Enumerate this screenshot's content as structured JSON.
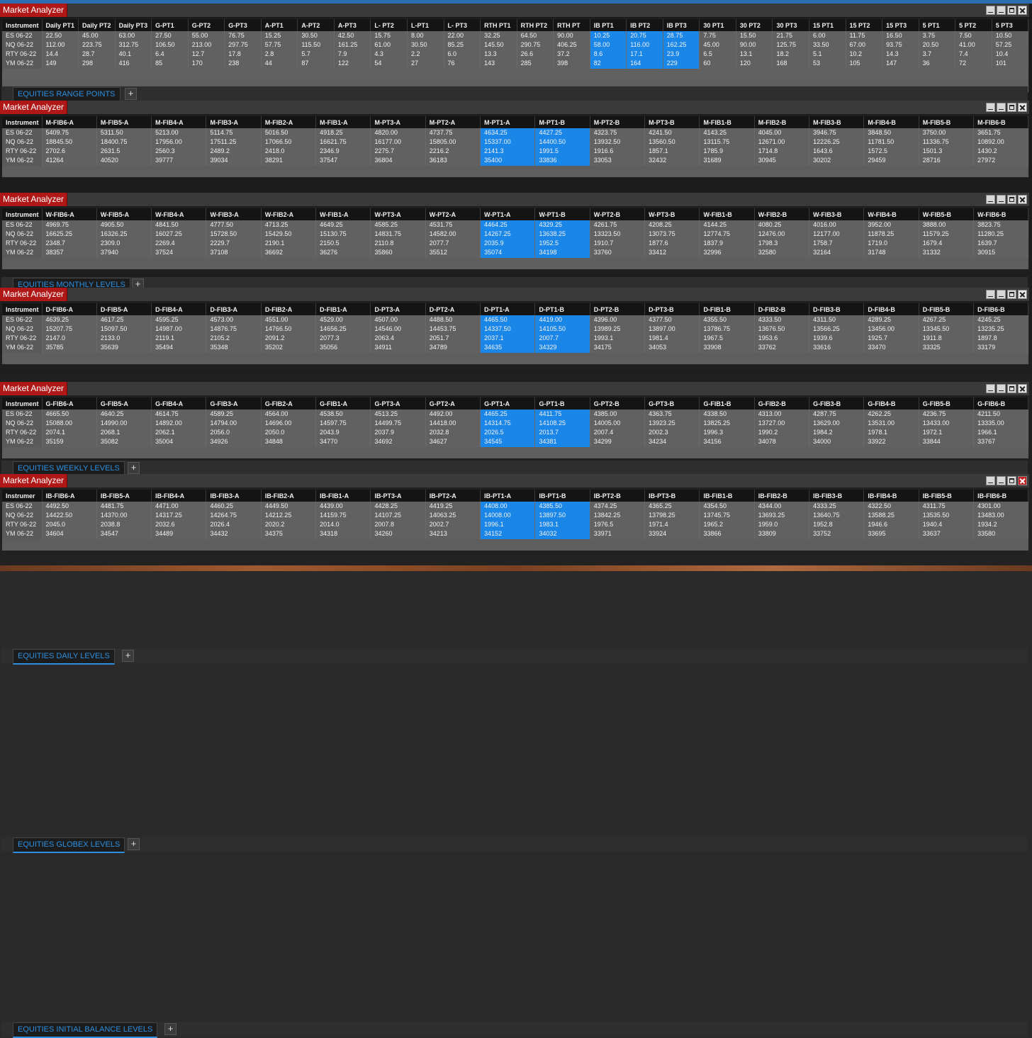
{
  "app": {
    "title": "Market Analyzer"
  },
  "panels": [
    {
      "tab": "EQUITIES RANGE POINTS",
      "headers": [
        "Instrument",
        "Daily PT1",
        "Daily PT2",
        "Daily PT3",
        "G-PT1",
        "G-PT2",
        "G-PT3",
        "A-PT1",
        "A-PT2",
        "A-PT3",
        "L- PT2",
        "L-PT1",
        "L- PT3",
        "RTH PT1",
        "RTH PT2",
        "RTH PT",
        "IB PT1",
        "IB PT2",
        "IB PT3",
        "30 PT1",
        "30 PT2",
        "30 PT3",
        "15 PT1",
        "15 PT2",
        "15 PT3",
        "5 PT1",
        "5 PT2",
        "5 PT3"
      ],
      "rows": [
        [
          "ES 06-22",
          "22.50",
          "45.00",
          "63.00",
          "27.50",
          "55.00",
          "76.75",
          "15.25",
          "30.50",
          "42.50",
          "15.75",
          "8.00",
          "22.00",
          "32.25",
          "64.50",
          "90.00",
          "10.25",
          "20.75",
          "28.75",
          "7.75",
          "15.50",
          "21.75",
          "6.00",
          "11.75",
          "16.50",
          "3.75",
          "7.50",
          "10.50"
        ],
        [
          "NQ 06-22",
          "112.00",
          "223.75",
          "312.75",
          "106.50",
          "213.00",
          "297.75",
          "57.75",
          "115.50",
          "161.25",
          "61.00",
          "30.50",
          "85.25",
          "145.50",
          "290.75",
          "406.25",
          "58.00",
          "116.00",
          "162.25",
          "45.00",
          "90.00",
          "125.75",
          "33.50",
          "67.00",
          "93.75",
          "20.50",
          "41.00",
          "57.25"
        ],
        [
          "RTY 06-22",
          "14.4",
          "28.7",
          "40.1",
          "6.4",
          "12.7",
          "17.8",
          "2.8",
          "5.7",
          "7.9",
          "4.3",
          "2.2",
          "6.0",
          "13.3",
          "26.6",
          "37.2",
          "8.6",
          "17.1",
          "23.9",
          "6.5",
          "13.1",
          "18.2",
          "5.1",
          "10.2",
          "14.3",
          "3.7",
          "7.4",
          "10.4"
        ],
        [
          "YM 06-22",
          "149",
          "298",
          "416",
          "85",
          "170",
          "238",
          "44",
          "87",
          "122",
          "54",
          "27",
          "76",
          "143",
          "285",
          "398",
          "82",
          "164",
          "229",
          "60",
          "120",
          "168",
          "53",
          "105",
          "147",
          "36",
          "72",
          "101"
        ]
      ]
    },
    {
      "tab": "EQUITIES MONTHLY LEVELS",
      "headers": [
        "Instrument",
        "M-FIB6-A",
        "M-FIB5-A",
        "M-FIB4-A",
        "M-FIB3-A",
        "M-FIB2-A",
        "M-FIB1-A",
        "M-PT3-A",
        "M-PT2-A",
        "M-PT1-A",
        "M-PT1-B",
        "M-PT2-B",
        "M-PT3-B",
        "M-FIB1-B",
        "M-FIB2-B",
        "M-FIB3-B",
        "M-FIB4-B",
        "M-FIB5-B",
        "M-FIB6-B"
      ],
      "rows": [
        [
          "ES 06-22",
          "5409.75",
          "5311.50",
          "5213.00",
          "5114.75",
          "5016.50",
          "4918.25",
          "4820.00",
          "4737.75",
          "4634.25",
          "4427.25",
          "4323.75",
          "4241.50",
          "4143.25",
          "4045.00",
          "3946.75",
          "3848.50",
          "3750.00",
          "3651.75"
        ],
        [
          "NQ 06-22",
          "18845.50",
          "18400.75",
          "17956.00",
          "17511.25",
          "17066.50",
          "16621.75",
          "16177.00",
          "15805.00",
          "15337.00",
          "14400.50",
          "13932.50",
          "13560.50",
          "13115.75",
          "12671.00",
          "12226.25",
          "11781.50",
          "11336.75",
          "10892.00"
        ],
        [
          "RTY 06-22",
          "2702.6",
          "2631.5",
          "2560.3",
          "2489.2",
          "2418.0",
          "2346.9",
          "2275.7",
          "2216.2",
          "2141.3",
          "1991.5",
          "1916.6",
          "1857.1",
          "1785.9",
          "1714.8",
          "1643.6",
          "1572.5",
          "1501.3",
          "1430.2"
        ],
        [
          "YM 06-22",
          "41264",
          "40520",
          "39777",
          "39034",
          "38291",
          "37547",
          "36804",
          "36183",
          "35400",
          "33836",
          "33053",
          "32432",
          "31689",
          "30945",
          "30202",
          "29459",
          "28716",
          "27972"
        ]
      ]
    },
    {
      "tab": "EQUITIES WEEKLY LEVELS",
      "headers": [
        "Instrument",
        "W-FIB6-A",
        "W-FIB5-A",
        "W-FIB4-A",
        "W-FIB3-A",
        "W-FIB2-A",
        "W-FIB1-A",
        "W-PT3-A",
        "W-PT2-A",
        "W-PT1-A",
        "W-PT1-B",
        "W-PT2-B",
        "W-PT3-B",
        "W-FIB1-B",
        "W-FIB2-B",
        "W-FIB3-B",
        "W-FIB4-B",
        "W-FIB5-B",
        "W-FIB6-B"
      ],
      "rows": [
        [
          "ES 06-22",
          "4969.75",
          "4905.50",
          "4841.50",
          "4777.50",
          "4713.25",
          "4649.25",
          "4585.25",
          "4531.75",
          "4464.25",
          "4329.25",
          "4261.75",
          "4208.25",
          "4144.25",
          "4080.25",
          "4016.00",
          "3952.00",
          "3888.00",
          "3823.75"
        ],
        [
          "NQ 06-22",
          "16625.25",
          "16326.25",
          "16027.25",
          "15728.50",
          "15429.50",
          "15130.75",
          "14831.75",
          "14582.00",
          "14267.25",
          "13638.25",
          "13323.50",
          "13073.75",
          "12774.75",
          "12476.00",
          "12177.00",
          "11878.25",
          "11579.25",
          "11280.25"
        ],
        [
          "RTY 06-22",
          "2348.7",
          "2309.0",
          "2269.4",
          "2229.7",
          "2190.1",
          "2150.5",
          "2110.8",
          "2077.7",
          "2035.9",
          "1952.5",
          "1910.7",
          "1877.6",
          "1837.9",
          "1798.3",
          "1758.7",
          "1719.0",
          "1679.4",
          "1639.7"
        ],
        [
          "YM 06-22",
          "38357",
          "37940",
          "37524",
          "37108",
          "36692",
          "36276",
          "35860",
          "35512",
          "35074",
          "34198",
          "33760",
          "33412",
          "32996",
          "32580",
          "32164",
          "31748",
          "31332",
          "30915"
        ]
      ]
    },
    {
      "tab": "EQUITIES DAILY LEVELS",
      "headers": [
        "Instrument",
        "D-FIB6-A",
        "D-FIB5-A",
        "D-FIB4-A",
        "D-FIB3-A",
        "D-FIB2-A",
        "D-FIB1-A",
        "D-PT3-A",
        "D-PT2-A",
        "D-PT1-A",
        "D-PT1-B",
        "D-PT2-B",
        "D-PT3-B",
        "D-FIB1-B",
        "D-FIB2-B",
        "D-FIB3-B",
        "D-FIB4-B",
        "D-FIB5-B",
        "D-FIB6-B"
      ],
      "rows": [
        [
          "ES 06-22",
          "4639.25",
          "4617.25",
          "4595.25",
          "4573.00",
          "4551.00",
          "4529.00",
          "4507.00",
          "4488.50",
          "4465.50",
          "4419.00",
          "4396.00",
          "4377.50",
          "4355.50",
          "4333.50",
          "4311.50",
          "4289.25",
          "4267.25",
          "4245.25"
        ],
        [
          "NQ 06-22",
          "15207.75",
          "15097.50",
          "14987.00",
          "14876.75",
          "14766.50",
          "14656.25",
          "14546.00",
          "14453.75",
          "14337.50",
          "14105.50",
          "13989.25",
          "13897.00",
          "13786.75",
          "13676.50",
          "13566.25",
          "13456.00",
          "13345.50",
          "13235.25"
        ],
        [
          "RTY 06-22",
          "2147.0",
          "2133.0",
          "2119.1",
          "2105.2",
          "2091.2",
          "2077.3",
          "2063.4",
          "2051.7",
          "2037.1",
          "2007.7",
          "1993.1",
          "1981.4",
          "1967.5",
          "1953.6",
          "1939.6",
          "1925.7",
          "1911.8",
          "1897.8"
        ],
        [
          "YM 06-22",
          "35785",
          "35639",
          "35494",
          "35348",
          "35202",
          "35056",
          "34911",
          "34789",
          "34635",
          "34329",
          "34175",
          "34053",
          "33908",
          "33762",
          "33616",
          "33470",
          "33325",
          "33179"
        ]
      ]
    },
    {
      "tab": "EQUITIES GLOBEX LEVELS",
      "headers": [
        "Instrument",
        "G-FIB6-A",
        "G-FIB5-A",
        "G-FIB4-A",
        "G-FIB3-A",
        "G-FIB2-A",
        "G-FIB1-A",
        "G-PT3-A",
        "G-PT2-A",
        "G-PT1-A",
        "G-PT1-B",
        "G-PT2-B",
        "G-PT3-B",
        "G-FIB1-B",
        "G-FIB2-B",
        "G-FIB3-B",
        "G-FIB4-B",
        "G-FIB5-B",
        "G-FIB6-B"
      ],
      "rows": [
        [
          "ES 06-22",
          "4665.50",
          "4640.25",
          "4614.75",
          "4589.25",
          "4564.00",
          "4538.50",
          "4513.25",
          "4492.00",
          "4465.25",
          "4411.75",
          "4385.00",
          "4363.75",
          "4338.50",
          "4313.00",
          "4287.75",
          "4262.25",
          "4236.75",
          "4211.50"
        ],
        [
          "NQ 06-22",
          "15088.00",
          "14990.00",
          "14892.00",
          "14794.00",
          "14696.00",
          "14597.75",
          "14499.75",
          "14418.00",
          "14314.75",
          "14108.25",
          "14005.00",
          "13923.25",
          "13825.25",
          "13727.00",
          "13629.00",
          "13531.00",
          "13433.00",
          "13335.00"
        ],
        [
          "RTY 06-22",
          "2074.1",
          "2068.1",
          "2062.1",
          "2056.0",
          "2050.0",
          "2043.9",
          "2037.9",
          "2032.8",
          "2026.5",
          "2013.7",
          "2007.4",
          "2002.3",
          "1996.3",
          "1990.2",
          "1984.2",
          "1978.1",
          "1972.1",
          "1966.1"
        ],
        [
          "YM 06-22",
          "35159",
          "35082",
          "35004",
          "34926",
          "34848",
          "34770",
          "34692",
          "34627",
          "34545",
          "34381",
          "34299",
          "34234",
          "34156",
          "34078",
          "34000",
          "33922",
          "33844",
          "33767"
        ]
      ]
    },
    {
      "tab": "EQUITIES INITIAL BALANCE LEVELS",
      "headers": [
        "Instrumer",
        "IB-FIB6-A",
        "IB-FIB5-A",
        "IB-FIB4-A",
        "IB-FIB3-A",
        "IB-FIB2-A",
        "IB-FIB1-A",
        "IB-PT3-A",
        "IB-PT2-A",
        "IB-PT1-A",
        "IB-PT1-B",
        "IB-PT2-B",
        "IB-PT3-B",
        "IB-FIB1-B",
        "IB-FIB2-B",
        "IB-FIB3-B",
        "IB-FIB4-B",
        "IB-FIB5-B",
        "IB-FIB6-B"
      ],
      "rows": [
        [
          "ES 06-22",
          "4492.50",
          "4481.75",
          "4471.00",
          "4460.25",
          "4449.50",
          "4439.00",
          "4428.25",
          "4419.25",
          "4408.00",
          "4385.50",
          "4374.25",
          "4365.25",
          "4354.50",
          "4344.00",
          "4333.25",
          "4322.50",
          "4311.75",
          "4301.00"
        ],
        [
          "NQ 06-22",
          "14422.50",
          "14370.00",
          "14317.25",
          "14264.75",
          "14212.25",
          "14159.75",
          "14107.25",
          "14063.25",
          "14008.00",
          "13897.50",
          "13842.25",
          "13798.25",
          "13745.75",
          "13693.25",
          "13640.75",
          "13588.25",
          "13535.50",
          "13483.00"
        ],
        [
          "RTY 06-22",
          "2045.0",
          "2038.8",
          "2032.6",
          "2026.4",
          "2020.2",
          "2014.0",
          "2007.8",
          "2002.7",
          "1996.1",
          "1983.1",
          "1976.5",
          "1971.4",
          "1965.2",
          "1959.0",
          "1952.8",
          "1946.6",
          "1940.4",
          "1934.2"
        ],
        [
          "YM 06-22",
          "34604",
          "34547",
          "34489",
          "34432",
          "34375",
          "34318",
          "34260",
          "34213",
          "34152",
          "34032",
          "33971",
          "33924",
          "33866",
          "33809",
          "33752",
          "33695",
          "33637",
          "33580"
        ]
      ]
    }
  ],
  "colors": {
    "title_tab": "#b01818",
    "highlight": "#1a86e8",
    "sheet_tab_text": "#2d8fe0"
  },
  "icons": {
    "minimize": "minimize-icon",
    "restore": "restore-icon",
    "maximize": "maximize-icon",
    "close": "close-icon",
    "add": "plus-icon"
  },
  "add_tab_symbol": "+"
}
